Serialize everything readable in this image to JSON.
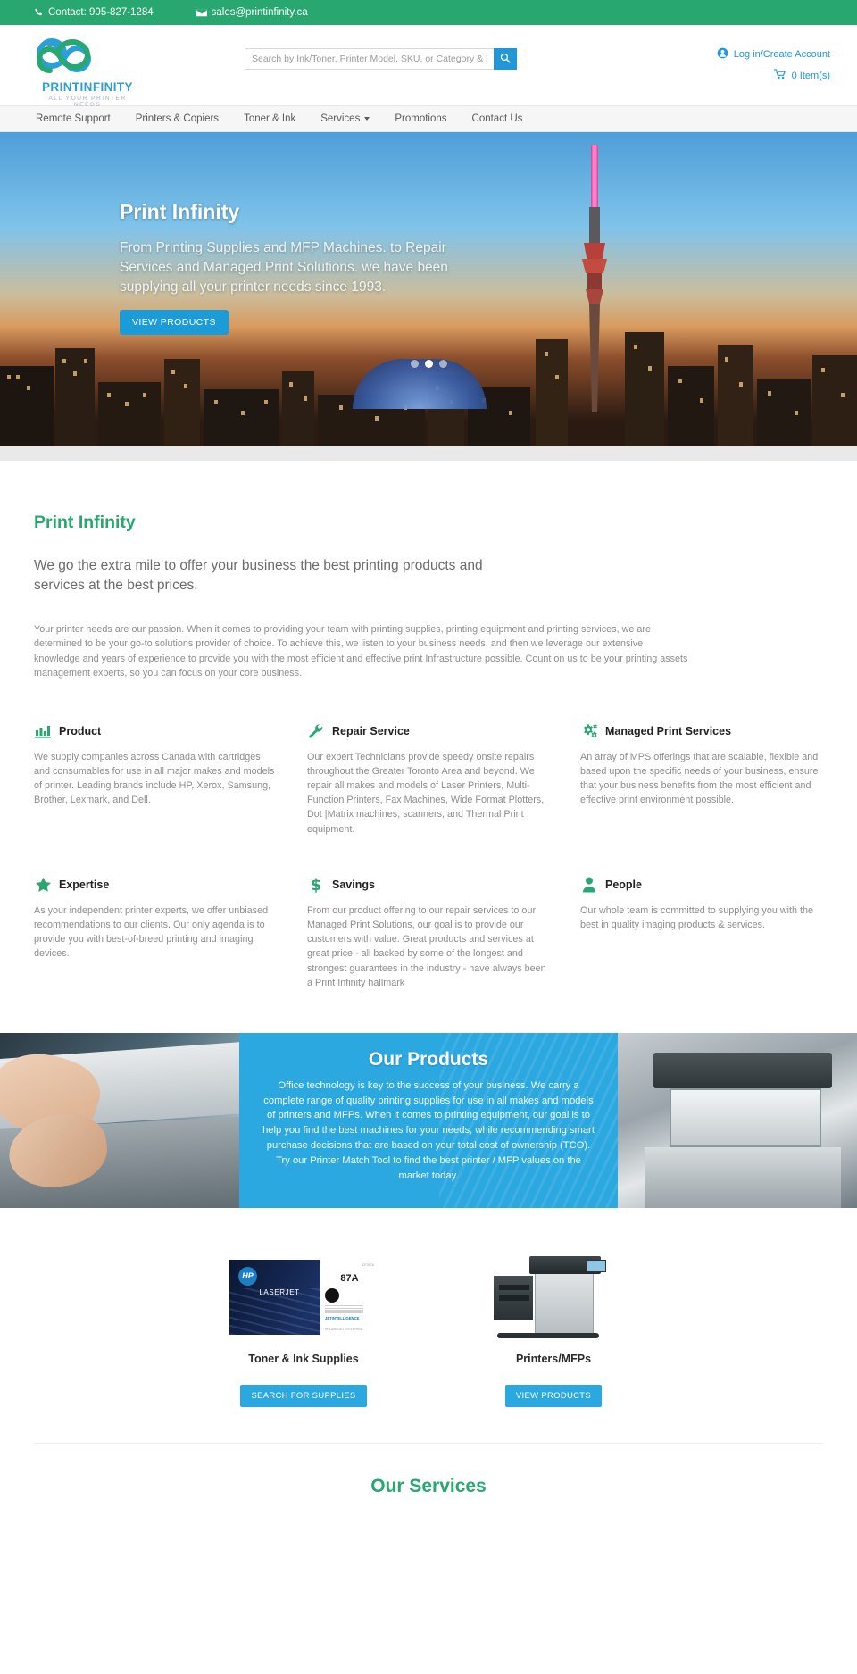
{
  "topbar": {
    "phone": "Contact: 905-827-1284",
    "email": "sales@printinfinity.ca",
    "phone_icon": "phone-icon",
    "email_icon": "envelope-icon",
    "bg_color": "#28a870"
  },
  "header": {
    "logo_name": "PRINTINFINITY",
    "logo_tagline": "ALL YOUR PRINTER NEEDS",
    "search_placeholder": "Search by Ink/Toner, Printer Model, SKU, or Category & Press Enter",
    "search_value": "",
    "search_icon": "search-icon",
    "account_label": "Log in/Create Account",
    "account_icon": "user-circle-icon",
    "cart_label": "0 Item(s)",
    "cart_icon": "shopping-cart-icon",
    "accent_color": "#2196d8"
  },
  "nav": {
    "items": [
      {
        "label": "Remote Support",
        "has_caret": false
      },
      {
        "label": "Printers & Copiers",
        "has_caret": false
      },
      {
        "label": "Toner & Ink",
        "has_caret": false
      },
      {
        "label": "Services",
        "has_caret": true
      },
      {
        "label": "Promotions",
        "has_caret": false
      },
      {
        "label": "Contact Us",
        "has_caret": false
      }
    ]
  },
  "hero": {
    "title": "Print Infinity",
    "subtitle": "From Printing Supplies and MFP Machines. to Repair Services and Managed Print Solutions. we have been supplying all your printer needs since 1993.",
    "button_label": "VIEW PRODUCTS",
    "dots": 3,
    "active_dot": 1
  },
  "about": {
    "title": "Print Infinity",
    "lead": "We go the extra mile to offer your business the best printing products and services at the best prices.",
    "body": "Your printer needs are our passion. When it comes to providing your team with printing supplies, printing equipment and printing services, we are determined to be your go-to solutions provider of choice. To achieve this, we listen to your business needs, and then we leverage our extensive knowledge and years of experience to provide you with the most efficient and effective print Infrastructure possible. Count on us to be your printing assets management experts, so you can focus on your core business."
  },
  "features": [
    {
      "icon": "bar-chart-icon",
      "title": "Product",
      "text": "We supply companies across Canada with cartridges and consumables for use in all major makes and models of printer. Leading brands include HP, Xerox, Samsung, Brother, Lexmark, and Dell."
    },
    {
      "icon": "wrench-icon",
      "title": "Repair Service",
      "text": "Our expert Technicians provide speedy onsite repairs throughout the Greater Toronto Area and beyond. We repair all makes and models of Laser Printers, Multi-Function Printers, Fax Machines, Wide Format Plotters, Dot |Matrix machines, scanners, and Thermal Print equipment."
    },
    {
      "icon": "gears-icon",
      "title": "Managed Print Services",
      "text": "An array of MPS offerings that are scalable, flexible and based upon the specific needs of your business, ensure that your business benefits from the most efficient and effective print environment possible."
    },
    {
      "icon": "star-icon",
      "title": "Expertise",
      "text": "As your independent printer experts, we offer unbiased recommendations to our clients. Our only agenda is to provide you with best-of-breed printing and imaging devices."
    },
    {
      "icon": "dollar-icon",
      "title": "Savings",
      "text": "From our product offering to our repair services to our Managed Print Solutions, our goal is to provide our customers with value. Great products and services at great price - all backed by some of the longest and strongest guarantees in the industry - have always been a Print Infinity hallmark"
    },
    {
      "icon": "person-icon",
      "title": "People",
      "text": "Our whole team is committed to supplying you with the best in quality imaging products & services."
    }
  ],
  "products_banner": {
    "title": "Our Products",
    "text": "Office technology is key to the success of your business. We carry a complete range of quality printing supplies for use in all makes and models of printers and MFPs. When it comes to printing equipment, our goal is to help you find the best machines for your needs, while recommending smart purchase decisions that are based on your total cost of ownership (TCO). Try our Printer Match Tool to find the best printer / MFP values on the market today.",
    "bg_color": "#2ca8e0",
    "left_image": "scanner-hands-photo",
    "right_image": "mfp-copier-photo"
  },
  "cards": [
    {
      "image": "hp-laserjet-toner-box",
      "brand": "HP",
      "brand_line": "LASERJET",
      "model_number": "87",
      "model_letter": "A",
      "sku": "CF287A",
      "badge": "JETINTELLIGENCE",
      "title": "Toner & Ink Supplies",
      "button_label": "SEARCH FOR SUPPLIES"
    },
    {
      "image": "multifunction-printer-photo",
      "title": "Printers/MFPs",
      "button_label": "VIEW PRODUCTS"
    }
  ],
  "services_section": {
    "title": "Our Services"
  }
}
